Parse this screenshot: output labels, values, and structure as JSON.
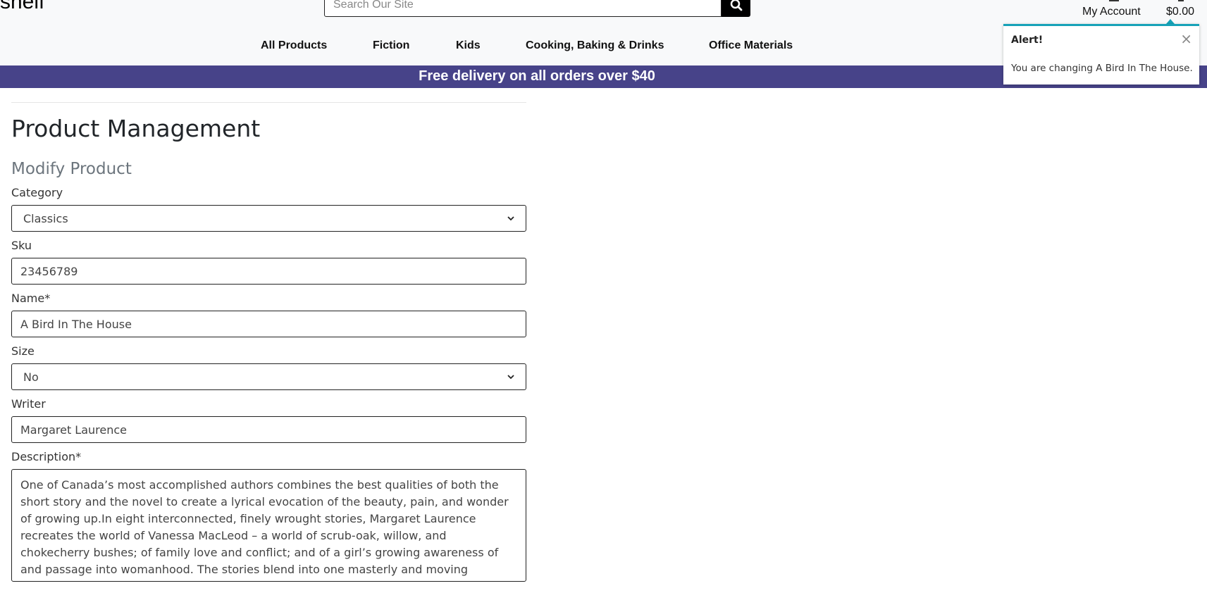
{
  "header": {
    "logo_text": "shelf",
    "search_placeholder": "Search Our Site",
    "account_label": "My Account",
    "cart_total": "$0.00"
  },
  "nav": {
    "items": [
      {
        "label": "All Products"
      },
      {
        "label": "Fiction"
      },
      {
        "label": "Kids"
      },
      {
        "label": "Cooking, Baking & Drinks"
      },
      {
        "label": "Office Materials"
      }
    ]
  },
  "banner": {
    "text": "Free delivery on all orders over $40"
  },
  "alert": {
    "title": "Alert!",
    "close": "×",
    "message": "You are changing A Bird In The House."
  },
  "page": {
    "title": "Product Management",
    "subtitle": "Modify Product"
  },
  "form": {
    "category_label": "Category",
    "category_value": "Classics",
    "sku_label": "Sku",
    "sku_value": "23456789",
    "name_label": "Name*",
    "name_value": "A Bird In The House",
    "size_label": "Size",
    "size_value": "No",
    "writer_label": "Writer",
    "writer_value": "Margaret Laurence",
    "description_label": "Description*",
    "description_value": "One of Canada’s most accomplished authors combines the best qualities of both the short story and the novel to create a lyrical evocation of the beauty, pain, and wonder of growing up.In eight interconnected, finely wrought stories, Margaret Laurence recreates the world of Vanessa MacLeod – a world of scrub-oak, willow, and chokecherry bushes; of family love and conflict; and of a girl’s growing awareness of and passage into womanhood. The stories blend into one masterly and moving poignant, compassionate, and profound in emotional"
  }
}
